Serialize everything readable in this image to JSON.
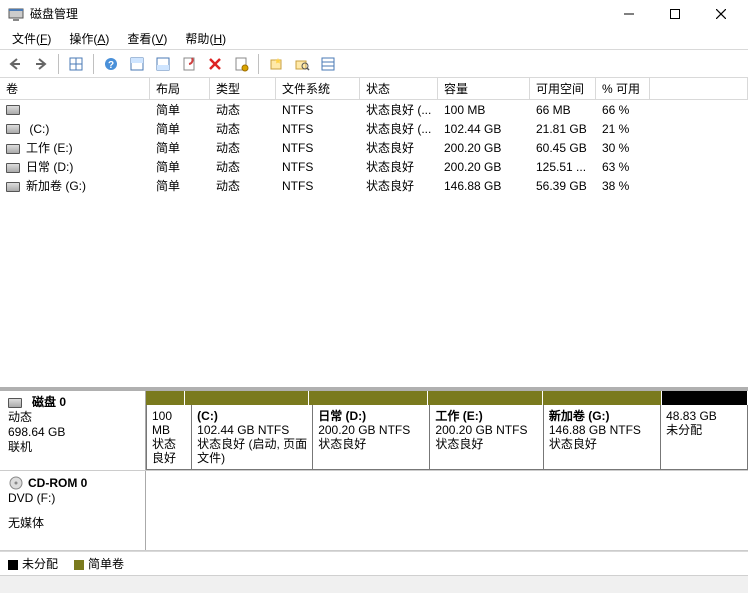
{
  "window": {
    "title": "磁盘管理",
    "min_tooltip": "Minimize",
    "max_tooltip": "Maximize",
    "close_tooltip": "Close"
  },
  "menu": {
    "file": "文件",
    "file_u": "F",
    "action": "操作",
    "action_u": "A",
    "view": "查看",
    "view_u": "V",
    "help": "帮助",
    "help_u": "H"
  },
  "columns": {
    "volume": "卷",
    "layout": "布局",
    "type": "类型",
    "fs": "文件系统",
    "status": "状态",
    "capacity": "容量",
    "free": "可用空间",
    "pctfree": "% 可用"
  },
  "volumes": [
    {
      "name": "",
      "layout": "简单",
      "type": "动态",
      "fs": "NTFS",
      "status": "状态良好 (...",
      "cap": "100 MB",
      "free": "66 MB",
      "pct": "66 %"
    },
    {
      "name": " (C:)",
      "layout": "简单",
      "type": "动态",
      "fs": "NTFS",
      "status": "状态良好 (...",
      "cap": "102.44 GB",
      "free": "21.81 GB",
      "pct": "21 %"
    },
    {
      "name": "工作 (E:)",
      "layout": "简单",
      "type": "动态",
      "fs": "NTFS",
      "status": "状态良好",
      "cap": "200.20 GB",
      "free": "60.45 GB",
      "pct": "30 %"
    },
    {
      "name": "日常 (D:)",
      "layout": "简单",
      "type": "动态",
      "fs": "NTFS",
      "status": "状态良好",
      "cap": "200.20 GB",
      "free": "125.51 ...",
      "pct": "63 %"
    },
    {
      "name": "新加卷 (G:)",
      "layout": "简单",
      "type": "动态",
      "fs": "NTFS",
      "status": "状态良好",
      "cap": "146.88 GB",
      "free": "56.39 GB",
      "pct": "38 %"
    }
  ],
  "disk0": {
    "name": "磁盘 0",
    "type": "动态",
    "size": "698.64 GB",
    "status": "联机",
    "partitions": [
      {
        "title": "",
        "line2": "100 MB",
        "line3": "状态良好",
        "hdr_color": "simple",
        "grow": 0.45
      },
      {
        "title": "(C:)",
        "line2": "102.44 GB NTFS",
        "line3": "状态良好 (启动, 页面文件)",
        "hdr_color": "simple",
        "grow": 1.45
      },
      {
        "title": "日常  (D:)",
        "line2": "200.20 GB NTFS",
        "line3": "状态良好",
        "hdr_color": "simple",
        "grow": 1.4
      },
      {
        "title": "工作  (E:)",
        "line2": "200.20 GB NTFS",
        "line3": "状态良好",
        "hdr_color": "simple",
        "grow": 1.35
      },
      {
        "title": "新加卷  (G:)",
        "line2": "146.88 GB NTFS",
        "line3": "状态良好",
        "hdr_color": "simple",
        "grow": 1.4
      },
      {
        "title": "",
        "line2": "48.83 GB",
        "line3": "未分配",
        "hdr_color": "unalloc",
        "grow": 1.0
      }
    ]
  },
  "cdrom": {
    "name": "CD-ROM 0",
    "type": "DVD (F:)",
    "status": "无媒体"
  },
  "legend": {
    "unalloc": "未分配",
    "simple": "简单卷"
  },
  "colors": {
    "simple": "#7a7a1e",
    "unalloc": "#000000"
  }
}
